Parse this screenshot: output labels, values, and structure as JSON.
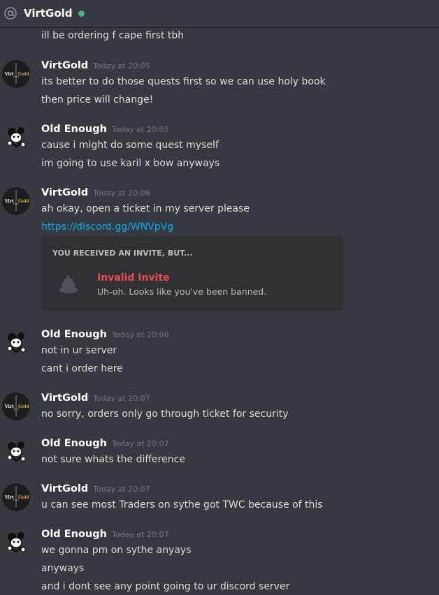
{
  "header": {
    "title": "VirtGold",
    "icon": "at-icon",
    "status_color": "#43b581"
  },
  "messages": {
    "m0": {
      "text": "ill be ordering f cape first tbh"
    },
    "m1": {
      "author": "VirtGold",
      "time": "Today at 20:05",
      "lines": [
        "its better to do those quests first so we can use holy book",
        "then price will change!"
      ]
    },
    "m2": {
      "author": "Old Enough",
      "time": "Today at 20:05",
      "lines": [
        "cause i might do some quest myself",
        "im going to use karil x bow anyways"
      ]
    },
    "m3": {
      "author": "VirtGold",
      "time": "Today at 20:06",
      "lines": [
        "ah okay, open a ticket in my server please",
        "https://discord.gg/WNVpVg"
      ]
    },
    "m4": {
      "author": "Old Enough",
      "time": "Today at 20:06",
      "lines": [
        "not in ur server",
        "cant i order here"
      ]
    },
    "m5": {
      "author": "VirtGold",
      "time": "Today at 20:07",
      "lines": [
        "no sorry, orders only go through ticket for security"
      ]
    },
    "m6": {
      "author": "Old Enough",
      "time": "Today at 20:07",
      "lines": [
        "not sure whats the difference"
      ]
    },
    "m7": {
      "author": "VirtGold",
      "time": "Today at 20:07",
      "lines": [
        "u can see most Traders on sythe got TWC because of this"
      ]
    },
    "m8": {
      "author": "Old Enough",
      "time": "Today at 20:07",
      "lines": [
        "we gonna pm on sythe anyays",
        "anyways",
        "and i dont see any point going to ur discord server"
      ]
    }
  },
  "invite": {
    "heading": "YOU RECEIVED AN INVITE, BUT...",
    "title": "Invalid Invite",
    "subtitle": "Uh-oh. Looks like you've been banned.",
    "icon": "poop-icon"
  },
  "avatars": {
    "virtgold": {
      "text_left": "Virt",
      "text_right": "Gold",
      "icon": "virtgold-logo-avatar"
    },
    "old_enough": {
      "icon": "cartoon-character-avatar"
    }
  },
  "colors": {
    "background": "#36393f",
    "link": "#00aff4",
    "error": "#f04747",
    "embed": "#2f3136"
  }
}
